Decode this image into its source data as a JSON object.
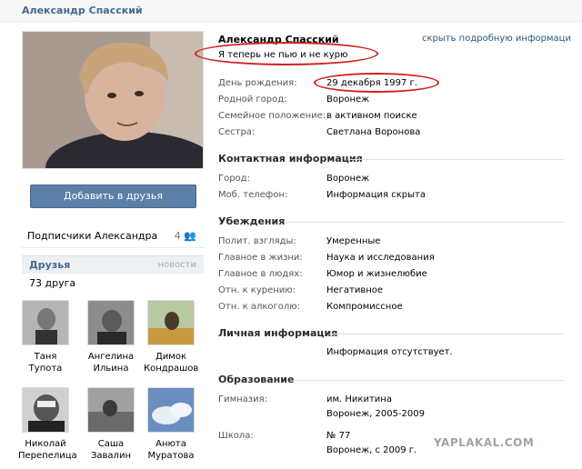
{
  "header": {
    "title": "Александр Спасский"
  },
  "profile": {
    "name": "Александр Спасский",
    "hide_link": "скрыть подробную информаци",
    "status": "Я теперь не пью и не курю",
    "add_friend_label": "Добавить в друзья",
    "followers_label": "Подписчики Александра",
    "followers_count": "4"
  },
  "info": [
    {
      "label": "День рождения:",
      "value": "29 декабря 1997 г."
    },
    {
      "label": "Родной город:",
      "value": "Воронеж"
    },
    {
      "label": "Семейное положение:",
      "value": "в активном поиске"
    },
    {
      "label": "Сестра:",
      "value": "Светлана Воронова"
    }
  ],
  "contacts": {
    "title": "Контактная информация",
    "rows": [
      {
        "label": "Город:",
        "value": "Воронеж"
      },
      {
        "label": "Моб. телефон:",
        "value": "Информация скрыта"
      }
    ]
  },
  "beliefs": {
    "title": "Убеждения",
    "rows": [
      {
        "label": "Полит. взгляды:",
        "value": "Умеренные"
      },
      {
        "label": "Главное в жизни:",
        "value": "Наука и исследования"
      },
      {
        "label": "Главное в людях:",
        "value": "Юмор и жизнелюбие"
      },
      {
        "label": "Отн. к курению:",
        "value": "Негативное"
      },
      {
        "label": "Отн. к алкоголю:",
        "value": "Компромиссное"
      }
    ]
  },
  "personal": {
    "title": "Личная информация",
    "empty": "Информация отсутствует."
  },
  "education": {
    "title": "Образование",
    "rows": [
      {
        "label": "Гимназия:",
        "value1": "им. Никитина",
        "value2": "Воронеж, 2005-2009"
      },
      {
        "label": "Школа:",
        "value1": "№ 77",
        "value2": "Воронеж, с 2009 г."
      }
    ]
  },
  "friends": {
    "title": "Друзья",
    "more": "новости",
    "count": "73 друга",
    "list": [
      {
        "first": "Таня",
        "last": "Тупота"
      },
      {
        "first": "Ангелина",
        "last": "Ильина"
      },
      {
        "first": "Димок",
        "last": "Кондрашов"
      },
      {
        "first": "Николай",
        "last": "Перепелица"
      },
      {
        "first": "Саша",
        "last": "Завалин"
      },
      {
        "first": "Анюта",
        "last": "Муратова"
      }
    ]
  },
  "watermark": "YAPLAKAL.COM",
  "colors": {
    "link": "#45688e",
    "accent": "#5b7fa6",
    "annotation": "#d21f1f"
  }
}
